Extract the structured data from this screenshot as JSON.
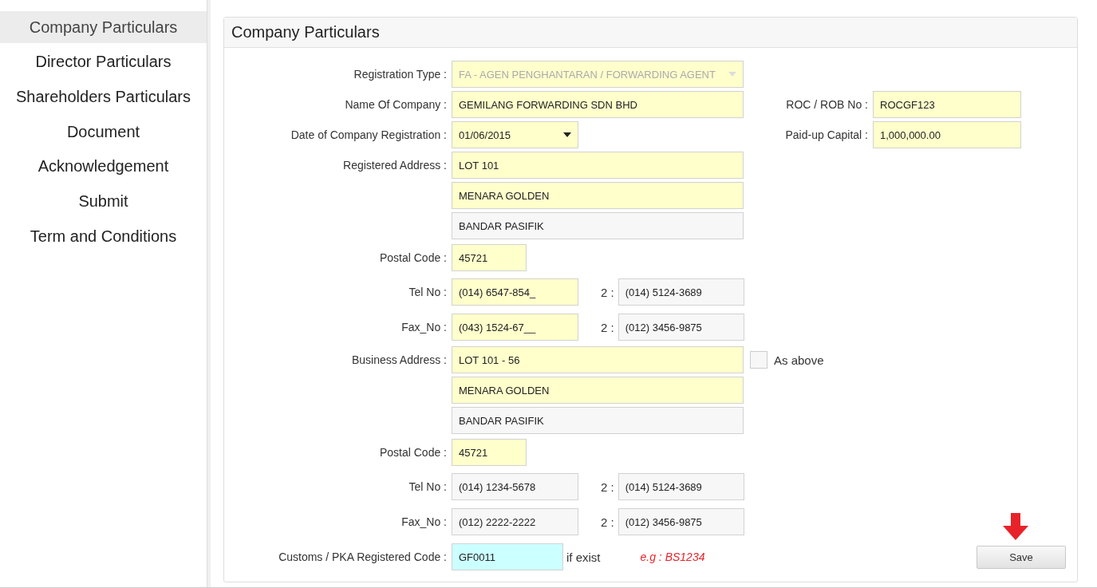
{
  "sidebar": {
    "items": [
      {
        "label": "Company Particulars",
        "selected": true
      },
      {
        "label": "Director Particulars",
        "selected": false
      },
      {
        "label": "Shareholders Particulars",
        "selected": false
      },
      {
        "label": "Document",
        "selected": false
      },
      {
        "label": "Acknowledgement",
        "selected": false
      },
      {
        "label": "Submit",
        "selected": false
      },
      {
        "label": "Term and Conditions",
        "selected": false
      }
    ]
  },
  "panel": {
    "title": "Company Particulars"
  },
  "rows": [
    {
      "kind": "select",
      "label": "Registration Type :",
      "value": "FA - AGEN PENGHANTARAN / FORWARDING AGENT",
      "disabled": true,
      "highlighted": true,
      "focused": false
    },
    {
      "kind": "text",
      "label": "Name Of Company :",
      "value": "GEMILANG FORWARDING SDN BHD",
      "highlighted": true,
      "focused": false,
      "side": {
        "label": "ROC / ROB No :",
        "value": "ROCGF123",
        "highlighted": true
      }
    },
    {
      "kind": "date",
      "label": "Date of Company Registration :",
      "value": "01/06/2015",
      "highlighted": true,
      "focused": false,
      "side": {
        "label": "Paid-up Capital :",
        "value": "1,000,000.00",
        "highlighted": true
      }
    },
    {
      "kind": "text",
      "label": "Registered Address :",
      "value": "LOT 101",
      "highlighted": true,
      "focused": false
    },
    {
      "kind": "text",
      "value": "MENARA GOLDEN",
      "highlighted": true,
      "focused": false
    },
    {
      "kind": "text",
      "value": "BANDAR PASIFIK",
      "highlighted": false,
      "focused": false
    },
    {
      "kind": "postal",
      "label": "Postal Code :",
      "value": "45721",
      "highlighted": true,
      "focused": false
    },
    {
      "kind": "phone",
      "label": "Tel No :",
      "value": "(014) 6547-854_",
      "highlighted": true,
      "focused": false,
      "second_label": "2 :",
      "second_value": "(014) 5124-3689",
      "second_highlighted": false
    },
    {
      "kind": "phone",
      "label": "Fax_No :",
      "value": "(043) 1524-67__",
      "highlighted": true,
      "focused": false,
      "second_label": "2 :",
      "second_value": "(012) 3456-9875",
      "second_highlighted": false
    },
    {
      "kind": "text",
      "label": "Business Address :",
      "value": "LOT 101 - 56",
      "highlighted": true,
      "focused": false,
      "check": {
        "label": "As above",
        "checked": false
      }
    },
    {
      "kind": "text",
      "value": "MENARA GOLDEN",
      "highlighted": true,
      "focused": false
    },
    {
      "kind": "text",
      "value": "BANDAR PASIFIK",
      "highlighted": false,
      "focused": false
    },
    {
      "kind": "postal",
      "label": "Postal Code :",
      "value": "45721",
      "highlighted": true,
      "focused": false
    },
    {
      "kind": "phone",
      "label": "Tel No :",
      "value": "(014) 1234-5678",
      "highlighted": false,
      "focused": false,
      "second_label": "2 :",
      "second_value": "(014) 5124-3689",
      "second_highlighted": false
    },
    {
      "kind": "phone",
      "label": "Fax_No :",
      "value": "(012) 2222-2222",
      "highlighted": false,
      "focused": false,
      "second_label": "2 :",
      "second_value": "(012) 3456-9875",
      "second_highlighted": false
    },
    {
      "kind": "code",
      "label": "Customs / PKA Registered Code :",
      "value": "GF0011",
      "highlighted": false,
      "focused": true,
      "suffix": "if exist",
      "example": "e.g : BS1234"
    }
  ],
  "save_button": {
    "label": "Save"
  }
}
